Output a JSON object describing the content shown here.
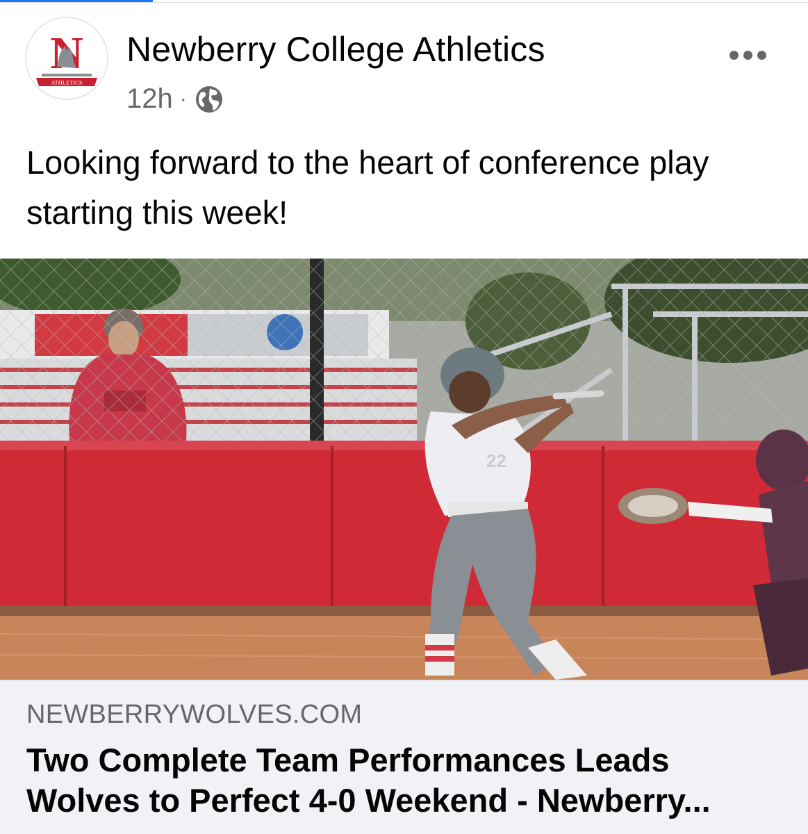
{
  "post": {
    "page_name": "Newberry College Athletics",
    "timestamp": "12h",
    "separator": "·",
    "audience_icon": "globe-icon",
    "text": "Looking forward to the heart of conference play starting this week!",
    "avatar_logo": {
      "letter": "N",
      "banner": "ATHLETICS",
      "brand_color": "#c8202f"
    }
  },
  "link_preview": {
    "domain": "NEWBERRYWOLVES.COM",
    "title": "Two Complete Team Performances Leads Wolves to Perfect 4-0 Weekend - Newberry..."
  },
  "photo": {
    "description_icon": "softball-batter-photo",
    "jersey_number": "22"
  },
  "colors": {
    "secondary_text": "#65676b",
    "card_background": "#f0f2f5",
    "wall_red": "#cf2a35",
    "dirt": "#c9855a"
  }
}
